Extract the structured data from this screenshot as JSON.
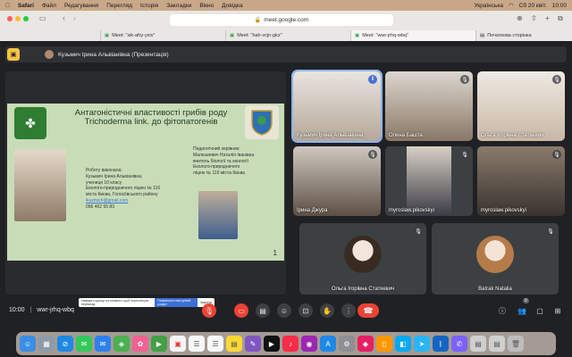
{
  "menubar": {
    "apple": "",
    "items": [
      "Safari",
      "Файл",
      "Редагування",
      "Перегляд",
      "Історія",
      "Закладки",
      "Вікно",
      "Довідка"
    ],
    "keyboard": "Українська",
    "date": "Сб 20 квіт.",
    "time": "10:00"
  },
  "browser": {
    "url": "meet.google.com",
    "bookmarks": [
      "HD",
      "G"
    ],
    "tabs": [
      {
        "label": "Meet: \"sik-afry-yxiv\""
      },
      {
        "label": "Meet: \"hah-vcjn-gkz\""
      },
      {
        "label": "Meet: \"wwr-jrhq-wbq\""
      },
      {
        "label": "Початкова сторінка"
      }
    ]
  },
  "meet": {
    "presenter_label": "Кузьмич Ірина Альвіанівна (Презентація)",
    "slide": {
      "title": "Антагоністичні властивості грибів роду Trichoderma link. до фітопатогенів",
      "author_block": [
        "Роботу виконала:",
        "Кузьмич Ірина Альвіанівна,",
        "учениця 10 класу",
        "Еколого-природничого ліцею № 116",
        "міста Києва, Голосіївського району",
        "ikuzmich@gmail.com",
        "096 462 55 83"
      ],
      "supervisor_block": [
        "Педагогічний керівник:",
        "Малюшевич Наталія Іванівна",
        "вчитель біології та екології",
        "Еколого-природничого",
        "ліцею № 116 міста Києва"
      ],
      "page_number": "1",
      "translate_bar": [
        "Наведіть курсор на елемент, щоб переглянути переклад",
        "Перекласти наступний розділ",
        "Закрити"
      ]
    },
    "participants": [
      {
        "name": "Кузьмич Ірина Альвіанівна",
        "mic": "active"
      },
      {
        "name": "Олена Башта",
        "mic": "muted"
      },
      {
        "name": "Ольга Ігорівна Статкевич",
        "mic": "muted"
      },
      {
        "name": "Ірина Джура",
        "mic": "muted"
      },
      {
        "name": "myroslaw.pikovskyi",
        "mic": "muted"
      },
      {
        "name": "myroslaw.pikovskyi",
        "mic": "muted"
      },
      {
        "name": "Ольга Ігорівна Статкевич",
        "mic": "muted"
      },
      {
        "name": "Batrak Natalia",
        "mic": "muted"
      }
    ],
    "meeting_time": "10:00",
    "meeting_code": "wwr-jrhq-wbq",
    "people_count": "9"
  }
}
